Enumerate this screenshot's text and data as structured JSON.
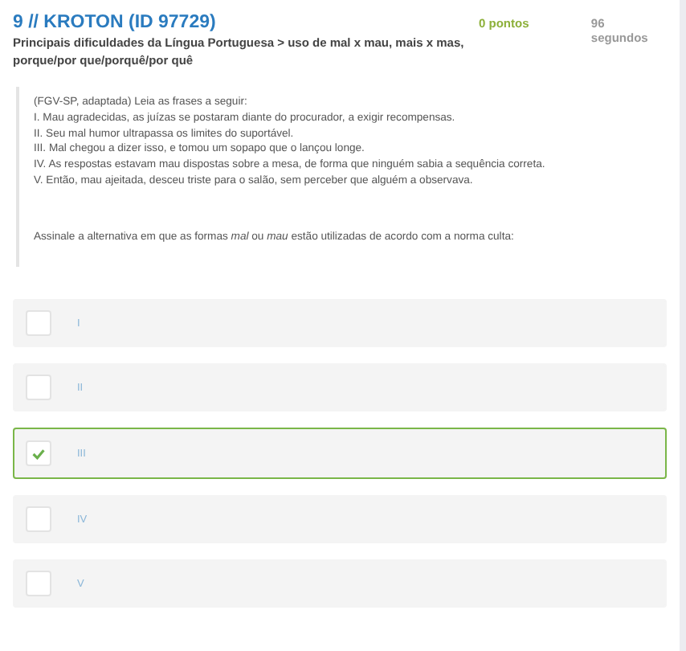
{
  "header": {
    "title": "9 // KROTON (ID 97729)",
    "subtitle": "Principais dificuldades da Língua Portuguesa > uso de mal x mau, mais x mas, porque/por que/porquê/por quê",
    "points": "0 pontos",
    "time": "96 segundos"
  },
  "question": {
    "intro": "(FGV-SP, adaptada) Leia as frases a seguir:",
    "sentences": [
      "I. Mau agradecidas, as juízas se postaram diante do procurador, a exigir recompensas.",
      "II. Seu mal humor ultrapassa os limites do suportável.",
      "III. Mal chegou a dizer isso, e tomou um sopapo que o lançou longe.",
      "IV. As respostas estavam mau dispostas sobre a mesa, de forma que ninguém sabia a sequência correta.",
      "V. Então, mau ajeitada, desceu triste para o salão, sem perceber que alguém a observava."
    ],
    "prompt": "Assinale a alternativa em que as formas *mal* ou *mau* estão utilizadas de acordo com a norma culta:"
  },
  "options": [
    {
      "label": "I",
      "selected": false
    },
    {
      "label": "II",
      "selected": false
    },
    {
      "label": "III",
      "selected": true
    },
    {
      "label": "IV",
      "selected": false
    },
    {
      "label": "V",
      "selected": false
    }
  ]
}
